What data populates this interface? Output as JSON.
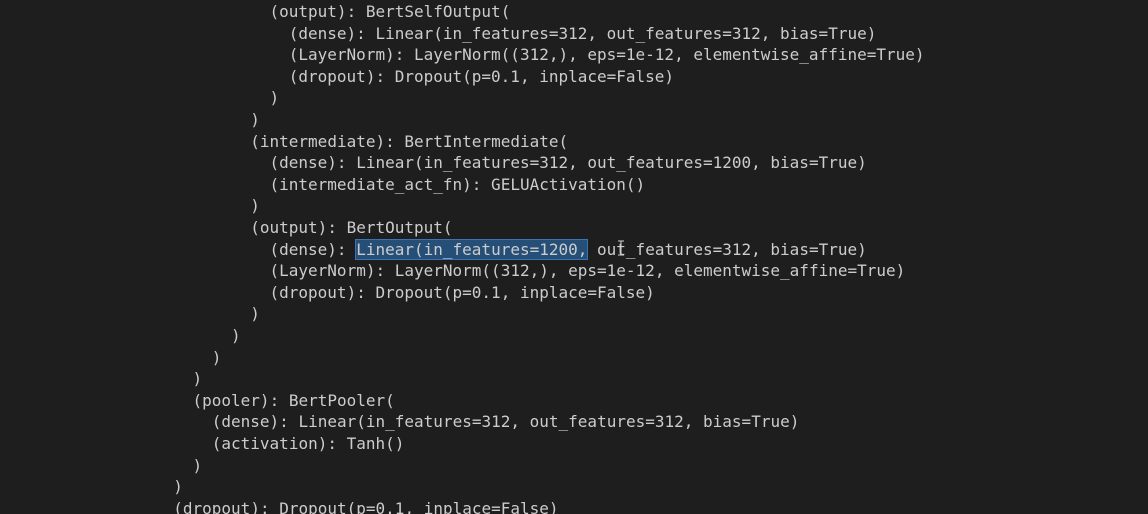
{
  "output": {
    "lines": [
      {
        "indent": 14,
        "text": "(output): BertSelfOutput("
      },
      {
        "indent": 15,
        "text": "(dense): Linear(in_features=312, out_features=312, bias=True)"
      },
      {
        "indent": 15,
        "text": "(LayerNorm): LayerNorm((312,), eps=1e-12, elementwise_affine=True)"
      },
      {
        "indent": 15,
        "text": "(dropout): Dropout(p=0.1, inplace=False)"
      },
      {
        "indent": 14,
        "text": ")"
      },
      {
        "indent": 13,
        "text": ")"
      },
      {
        "indent": 13,
        "text": "(intermediate): BertIntermediate("
      },
      {
        "indent": 14,
        "text": "(dense): Linear(in_features=312, out_features=1200, bias=True)"
      },
      {
        "indent": 14,
        "text": "(intermediate_act_fn): GELUActivation()"
      },
      {
        "indent": 13,
        "text": ")"
      },
      {
        "indent": 13,
        "text": "(output): BertOutput("
      },
      {
        "indent": 14,
        "before": "(dense): ",
        "selected": "Linear(in_features=1200,",
        "after": " out_features=312, bias=True)"
      },
      {
        "indent": 14,
        "text": "(LayerNorm): LayerNorm((312,), eps=1e-12, elementwise_affine=True)"
      },
      {
        "indent": 14,
        "text": "(dropout): Dropout(p=0.1, inplace=False)"
      },
      {
        "indent": 13,
        "text": ")"
      },
      {
        "indent": 12,
        "text": ")"
      },
      {
        "indent": 11,
        "text": ")"
      },
      {
        "indent": 10,
        "text": ")"
      },
      {
        "indent": 10,
        "text": "(pooler): BertPooler("
      },
      {
        "indent": 11,
        "text": "(dense): Linear(in_features=312, out_features=312, bias=True)"
      },
      {
        "indent": 11,
        "text": "(activation): Tanh()"
      },
      {
        "indent": 10,
        "text": ")"
      },
      {
        "indent": 9,
        "text": ")"
      },
      {
        "indent": 9,
        "text": "(dropout): Dropout(p=0.1, inplace=False)"
      }
    ]
  },
  "colors": {
    "background": "#1e1e1e",
    "text": "#cccccc",
    "selection": "#264f78"
  },
  "icons": {
    "cursor": "text-cursor-icon"
  }
}
